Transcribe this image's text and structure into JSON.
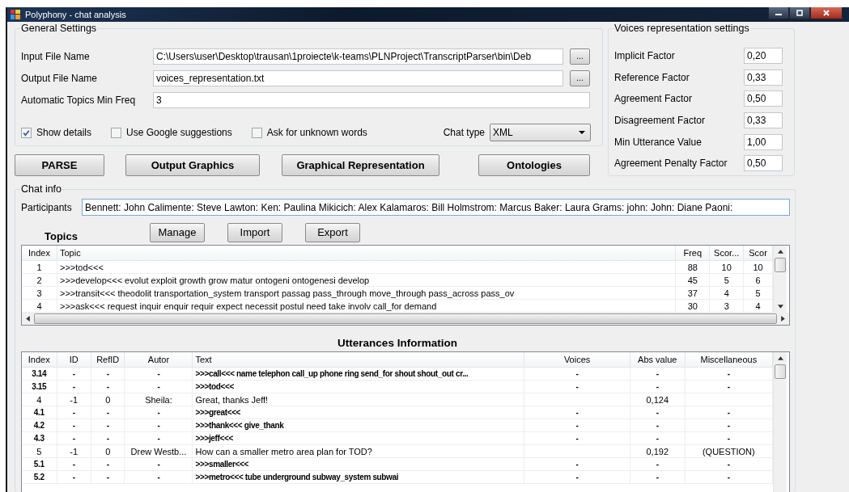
{
  "window": {
    "title": "Polyphony - chat analysis"
  },
  "general_settings": {
    "title": "General Settings",
    "fields": [
      {
        "label": "Input File Name",
        "value": "C:\\Users\\user\\Desktop\\trausan\\1proiecte\\k-teams\\PLNProject\\TranscriptParser\\bin\\Deb",
        "browse": "..."
      },
      {
        "label": "Output File Name",
        "value": "voices_representation.txt",
        "browse": "..."
      },
      {
        "label": "Automatic Topics Min Freq",
        "value": "3"
      }
    ],
    "options": [
      {
        "label": "Show details",
        "checked": true
      },
      {
        "label": "Use Google suggestions",
        "checked": false
      },
      {
        "label": "Ask for unknown words",
        "checked": false
      }
    ],
    "chat_type": {
      "label": "Chat type",
      "value": "XML"
    }
  },
  "actions": [
    "PARSE",
    "Output Graphics",
    "Graphical Representation",
    "Ontologies"
  ],
  "voices_settings": {
    "title": "Voices representation settings",
    "fields": [
      {
        "label": "Implicit Factor",
        "value": "0,20"
      },
      {
        "label": "Reference Factor",
        "value": "0,33"
      },
      {
        "label": "Agreement Factor",
        "value": "0,50"
      },
      {
        "label": "Disagreement Factor",
        "value": "0,33"
      },
      {
        "label": "Min Utterance Value",
        "value": "1,00"
      },
      {
        "label": "Agreement Penalty Factor",
        "value": "0,50"
      }
    ]
  },
  "chat_info": {
    "title": "Chat info",
    "participants": {
      "label": "Participants",
      "value": "Bennett: John Calimente: Steve Lawton: Ken: Paulina Mikicich: Alex Kalamaros: Bill Holmstrom: Marcus Baker: Laura Grams: john: John: Diane Paoni:"
    },
    "topics": {
      "title": "Topics",
      "buttons": [
        "Manage",
        "Import",
        "Export"
      ],
      "columns": [
        "Index",
        "Topic",
        "Freq",
        "Scor...",
        "Scor"
      ],
      "rows": [
        [
          "1",
          ">>>tod<<<",
          "88",
          "10",
          "10"
        ],
        [
          "2",
          ">>>develop<<< evolut exploit growth grow matur ontogeni ontogenesi develop",
          "45",
          "5",
          "6"
        ],
        [
          "3",
          ">>>transit<<< theodolit transportation_system transport passag pass_through move_through pass_across pass_ov",
          "37",
          "4",
          "5"
        ],
        [
          "4",
          ">>>ask<<< request inquir enquir requir expect necessit postul need take involv call_for demand",
          "30",
          "3",
          "4"
        ]
      ]
    }
  },
  "utterances": {
    "title": "Utterances Information",
    "columns": [
      "Index",
      "ID",
      "RefID",
      "Autor",
      "Text",
      "Voices",
      "Abs value",
      "Miscellaneous"
    ],
    "rows": [
      {
        "kind": "word",
        "cells": [
          "3.14",
          "-",
          "-",
          "-",
          ">>>call<<< name telephon call_up phone ring send_for shout shout_out cr...",
          "-",
          "-",
          "-"
        ]
      },
      {
        "kind": "word",
        "cells": [
          "3.15",
          "-",
          "-",
          "-",
          ">>>tod<<<",
          "-",
          "-",
          "-"
        ]
      },
      {
        "kind": "utterance",
        "cells": [
          "4",
          "-1",
          "0",
          "Sheila:",
          "Great, thanks Jeff!",
          "",
          "0,124",
          ""
        ]
      },
      {
        "kind": "word",
        "cells": [
          "4.1",
          "-",
          "-",
          "-",
          ">>>great<<<",
          "-",
          "-",
          "-"
        ]
      },
      {
        "kind": "word",
        "cells": [
          "4.2",
          "-",
          "-",
          "-",
          ">>>thank<<< give_thank",
          "-",
          "-",
          "-"
        ]
      },
      {
        "kind": "word",
        "cells": [
          "4.3",
          "-",
          "-",
          "-",
          ">>>jeff<<<",
          "-",
          "-",
          "-"
        ]
      },
      {
        "kind": "utterance",
        "cells": [
          "5",
          "-1",
          "0",
          "Drew Westb...",
          "How can a smaller metro area plan for TOD?",
          "",
          "0,192",
          "(QUESTION)"
        ]
      },
      {
        "kind": "word",
        "cells": [
          "5.1",
          "-",
          "-",
          "-",
          ">>>smaller<<<",
          "-",
          "-",
          "-"
        ]
      },
      {
        "kind": "word",
        "cells": [
          "5.2",
          "-",
          "-",
          "-",
          ">>>metro<<< tube underground subway_system subwai",
          "-",
          "-",
          "-"
        ]
      }
    ]
  }
}
